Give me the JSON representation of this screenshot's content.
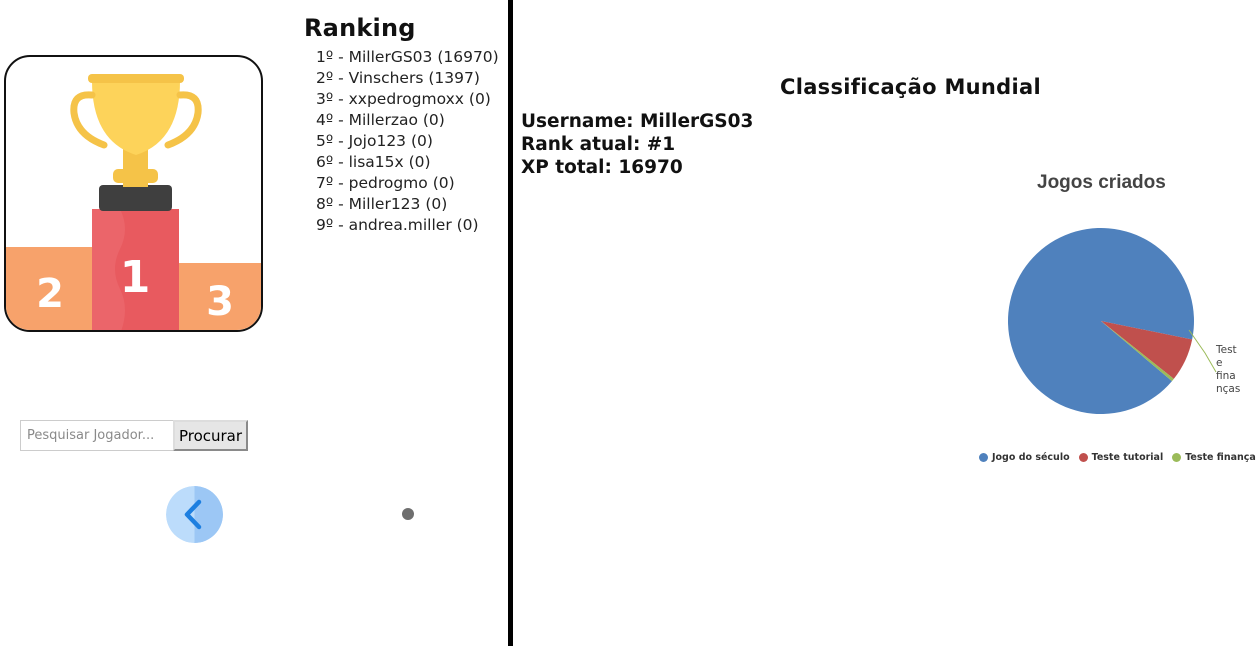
{
  "ranking": {
    "title": "Ranking",
    "entries": [
      "1º - MillerGS03 (16970)",
      "2º - Vinschers (1397)",
      "3º - xxpedrogmoxx (0)",
      "4º - Millerzao (0)",
      "5º - Jojo123 (0)",
      "6º - lisa15x (0)",
      "7º - pedrogmo (0)",
      "8º - Miller123 (0)",
      "9º - andrea.miller (0)"
    ]
  },
  "podium": {
    "first": "1",
    "second": "2",
    "third": "3"
  },
  "search": {
    "placeholder": "Pesquisar Jogador...",
    "button_label": "Procurar"
  },
  "icons": {
    "back": "chevron-left-icon",
    "trophy": "trophy-icon"
  },
  "world": {
    "title": "Classificação Mundial",
    "username": "Username: MillerGS03",
    "rank": "Rank atual: #1",
    "xp": "XP total: 16970"
  },
  "colors": {
    "series1": "#4f81bd",
    "series2": "#c0504d",
    "series3": "#9bbb59",
    "back_button": "#a9cdf7",
    "back_chevron": "#1d7fe0"
  },
  "chart_data": {
    "type": "pie",
    "title": "Jogos criados",
    "series": [
      {
        "name": "Jogo do século",
        "value": 92
      },
      {
        "name": "Teste tutorial",
        "value": 7.5
      },
      {
        "name": "Teste finanças",
        "value": 0.5
      }
    ],
    "slice_label": "Teste finanças",
    "legend": "bottom"
  }
}
